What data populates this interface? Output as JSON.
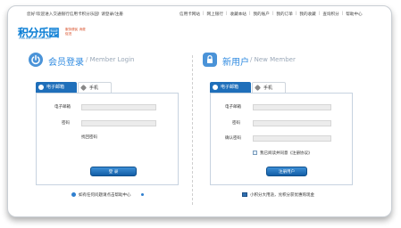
{
  "topbar": {
    "welcome_text": "您好!欢迎进入交通银行信用卡积分乐园!",
    "login_link": "请登录",
    "register_link": "注册",
    "nav": [
      "信用卡网站",
      "网上银行",
      "收藏本站",
      "我的账户",
      "我的订单",
      "我的收藏",
      "查询积分",
      "帮助中心"
    ]
  },
  "logo": {
    "main": "积分乐园",
    "url": "club.bankcomm.com",
    "sub": "服务便民 消费促进"
  },
  "login": {
    "title_cn": "会员登录",
    "title_en": "/ Member Login",
    "tabs": [
      "电子邮箱",
      "手机"
    ],
    "email_label": "电子邮箱",
    "password_label": "密码",
    "forgot_label": "找回密码",
    "submit_label": "登 录",
    "help_text": "如有任何问题请点击帮助中心"
  },
  "register": {
    "title_cn": "新用户",
    "title_en": "/ New Member",
    "tabs": [
      "电子邮箱",
      "手机"
    ],
    "email_label": "电子邮箱",
    "password_label": "密码",
    "confirm_label": "确认密码",
    "agree_text": "我已阅读并同意《注册协议》",
    "submit_label": "注册用户",
    "promo_text": "小积分大用途，兑积分获优惠购现金"
  },
  "colors": {
    "accent": "#2e8ae0",
    "tab_active": "#1f6fba",
    "button": "#135ea6"
  }
}
